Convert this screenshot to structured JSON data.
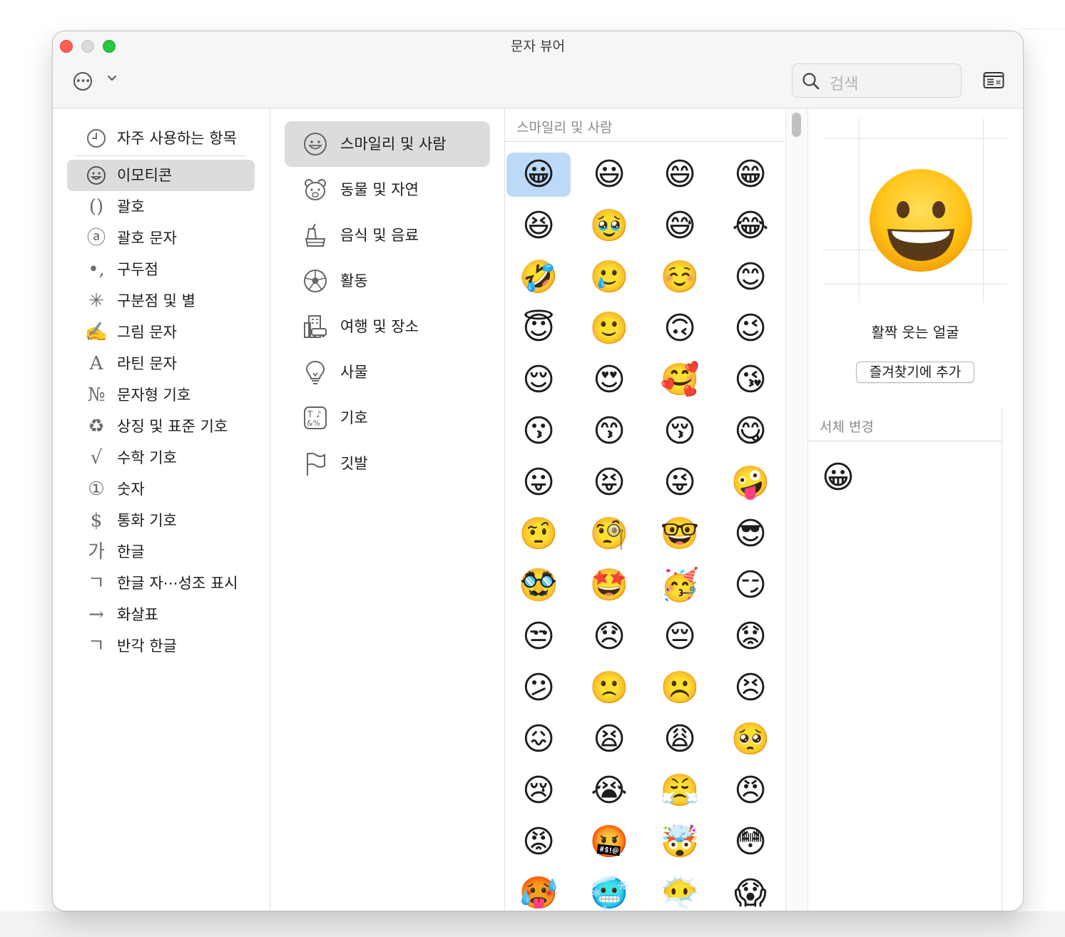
{
  "window": {
    "title": "문자 뷰어"
  },
  "toolbar": {
    "search_placeholder": "검색"
  },
  "sidebar": {
    "items": [
      {
        "icon": "clock-icon",
        "glyph": "",
        "label": "자주 사용하는 항목"
      },
      {
        "icon": "smiley-icon",
        "glyph": "",
        "label": "이모티콘",
        "selected": true
      },
      {
        "icon": "parentheses-icon",
        "glyph": "()",
        "label": "괄호"
      },
      {
        "icon": "circled-a-icon",
        "glyph": "ⓐ",
        "label": "괄호 문자"
      },
      {
        "icon": "punctuation-icon",
        "glyph": "•,",
        "label": "구두점"
      },
      {
        "icon": "asterisk-icon",
        "glyph": "✳",
        "label": "구분점 및 별"
      },
      {
        "icon": "pictograph-icon",
        "glyph": "✍",
        "label": "그림 문자"
      },
      {
        "icon": "latin-a-icon",
        "glyph": "A",
        "label": "라틴 문자"
      },
      {
        "icon": "numero-icon",
        "glyph": "№",
        "label": "문자형 기호"
      },
      {
        "icon": "recycle-icon",
        "glyph": "♻",
        "label": "상징 및 표준 기호"
      },
      {
        "icon": "sqrt-icon",
        "glyph": "√",
        "label": "수학 기호"
      },
      {
        "icon": "circled-one-icon",
        "glyph": "①",
        "label": "숫자"
      },
      {
        "icon": "dollar-icon",
        "glyph": "$",
        "label": "통화 기호"
      },
      {
        "icon": "hangul-ga-icon",
        "glyph": "가",
        "label": "한글"
      },
      {
        "icon": "hangul-giyeok-icon",
        "glyph": "ㄱ",
        "label": "한글 자⋯성조 표시"
      },
      {
        "icon": "arrow-icon",
        "glyph": "→",
        "label": "화살표"
      },
      {
        "icon": "halfwidth-giyeok-icon",
        "glyph": "ㄱ",
        "label": "반각 한글"
      }
    ]
  },
  "categories": [
    {
      "icon": "smiley-icon",
      "label": "스마일리 및 사람",
      "selected": true
    },
    {
      "icon": "bear-icon",
      "label": "동물 및 자연"
    },
    {
      "icon": "food-icon",
      "label": "음식 및 음료"
    },
    {
      "icon": "soccer-ball-icon",
      "label": "활동"
    },
    {
      "icon": "building-car-icon",
      "label": "여행 및 장소"
    },
    {
      "icon": "lightbulb-icon",
      "label": "사물"
    },
    {
      "icon": "symbols-icon",
      "label": "기호"
    },
    {
      "icon": "flag-icon",
      "label": "깃발"
    }
  ],
  "grid": {
    "header": "스마일리 및 사람",
    "emojis": [
      "😀",
      "😃",
      "😄",
      "😁",
      "😆",
      "🥹",
      "😅",
      "😂",
      "🤣",
      "🥲",
      "☺️",
      "😊",
      "😇",
      "🙂",
      "🙃",
      "😉",
      "😌",
      "😍",
      "🥰",
      "😘",
      "😗",
      "😙",
      "😚",
      "😋",
      "😛",
      "😝",
      "😜",
      "🤪",
      "🤨",
      "🧐",
      "🤓",
      "😎",
      "🥸",
      "🤩",
      "🥳",
      "😏",
      "😒",
      "😞",
      "😔",
      "😟",
      "😕",
      "🙁",
      "☹️",
      "😣",
      "😖",
      "😫",
      "😩",
      "🥺",
      "😢",
      "😭",
      "😤",
      "😠",
      "😡",
      "🤬",
      "🤯",
      "😳",
      "🥵",
      "🥶",
      "😶‍🌫️",
      "😱"
    ],
    "selected_index": 0
  },
  "detail": {
    "emoji": "😀",
    "name": "활짝 웃는 얼굴",
    "favorite_button": "즐겨찾기에 추가",
    "font_variation_header": "서체 변경",
    "font_variations": [
      "😀"
    ]
  }
}
